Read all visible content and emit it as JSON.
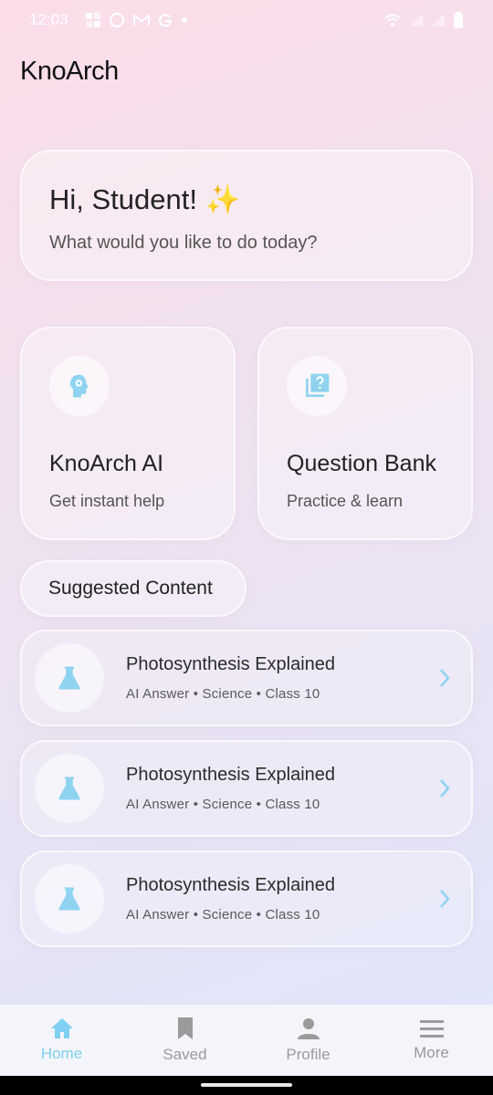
{
  "status_bar": {
    "time": "12:03",
    "notification_icons": [
      "app-icon",
      "whatsapp-icon",
      "gmail-icon",
      "google-icon",
      "dot-icon"
    ],
    "right_icons": [
      "wifi-icon",
      "signal-icon",
      "signal-icon",
      "battery-icon"
    ]
  },
  "app": {
    "title": "KnoArch"
  },
  "greeting": {
    "title": "Hi, Student! ✨",
    "subtitle": "What would you like to do today?"
  },
  "features": [
    {
      "title": "KnoArch AI",
      "subtitle": "Get instant help",
      "icon": "head-gear-icon"
    },
    {
      "title": "Question Bank",
      "subtitle": "Practice & learn",
      "icon": "question-bank-icon"
    }
  ],
  "suggested": {
    "heading": "Suggested Content",
    "items": [
      {
        "title": "Photosynthesis Explained",
        "meta": "AI Answer • Science • Class 10",
        "icon": "flask-icon"
      },
      {
        "title": "Photosynthesis Explained",
        "meta": "AI Answer • Science • Class 10",
        "icon": "flask-icon"
      },
      {
        "title": "Photosynthesis Explained",
        "meta": "AI Answer • Science • Class 10",
        "icon": "flask-icon"
      }
    ]
  },
  "nav": {
    "items": [
      {
        "label": "Home",
        "icon": "home-icon",
        "active": true
      },
      {
        "label": "Saved",
        "icon": "bookmark-icon",
        "active": false
      },
      {
        "label": "Profile",
        "icon": "person-icon",
        "active": false
      },
      {
        "label": "More",
        "icon": "menu-icon",
        "active": false
      }
    ]
  },
  "colors": {
    "accent": "#7fd0f2",
    "inactive_nav": "#9a9a9a"
  }
}
